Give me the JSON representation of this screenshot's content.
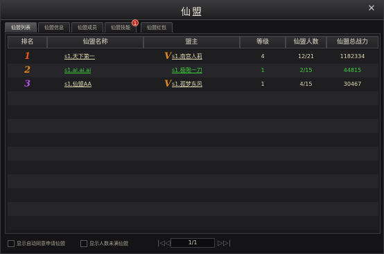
{
  "window": {
    "title": "仙盟",
    "close_symbol": "✕"
  },
  "tabs": [
    {
      "label": "仙盟列表",
      "active": true
    },
    {
      "label": "仙盟信息",
      "active": false
    },
    {
      "label": "仙盟成员",
      "active": false
    },
    {
      "label": "仙盟技能",
      "active": false,
      "badge": "1"
    },
    {
      "label": "仙盟红包",
      "active": false
    }
  ],
  "table": {
    "headers": [
      "排名",
      "仙盟名称",
      "盟主",
      "等级",
      "仙盟人数",
      "仙盟总战力"
    ],
    "rows": [
      {
        "rank": "1",
        "rank_color": "#e8581c",
        "name": "s1.天下第一",
        "name_color": "#e0d9b0",
        "vip": true,
        "vip_label": "V",
        "leader": "s1.南宫人莉",
        "leader_color": "#e0d9b0",
        "level": "4",
        "members": "12/21",
        "power": "1182334",
        "text_color": "#e0d9b0"
      },
      {
        "rank": "2",
        "rank_color": "#e8881c",
        "name": "s1.ai.ai.ai",
        "name_color": "#3ad43a",
        "vip": false,
        "vip_label": "",
        "leader": "s1.极限一刀",
        "leader_color": "#3ad43a",
        "level": "1",
        "members": "2/15",
        "power": "44815",
        "text_color": "#3ad43a"
      },
      {
        "rank": "3",
        "rank_color": "#b450e8",
        "name": "s1.仙盟AA",
        "name_color": "#e0d9b0",
        "vip": true,
        "vip_label": "V",
        "leader": "s1.孤梦东风",
        "leader_color": "#e0d9b0",
        "level": "1",
        "members": "4/15",
        "power": "30467",
        "text_color": "#e0d9b0"
      }
    ]
  },
  "footer": {
    "auto_accept_label": "显示自动同意申请仙盟",
    "show_not_full_label": "显示人数未满仙盟",
    "first_symbol": "|◁",
    "prev_symbol": "◁",
    "page": "1/1",
    "next_symbol": "▷",
    "last_symbol": "▷|"
  }
}
